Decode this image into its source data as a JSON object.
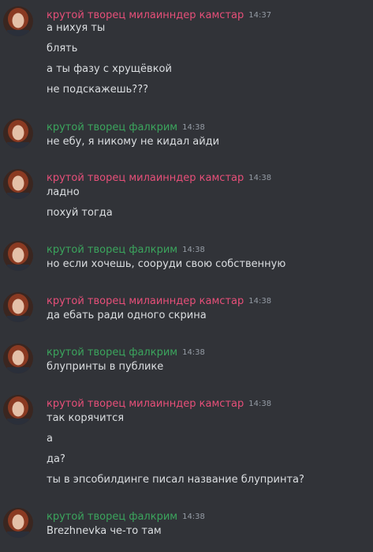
{
  "colors": {
    "background": "#313338",
    "user_pink": "#e74f79",
    "user_green": "#3ba55d",
    "text": "#dbdee1",
    "timestamp": "#949ba4"
  },
  "users": {
    "pink": "крутой творец милаинндер камстар",
    "green": "крутой творец фалкрим"
  },
  "messages": [
    {
      "user": "крутой творец милаинндер камстар",
      "color": "pink",
      "time": "14:37",
      "lines": [
        "а нихуя ты",
        "блять",
        "а ты фазу с хрущёвкой",
        "не подскажешь???"
      ]
    },
    {
      "user": "крутой творец фалкрим",
      "color": "green",
      "time": "14:38",
      "lines": [
        "не ебу, я никому не кидал айди"
      ]
    },
    {
      "user": "крутой творец милаинндер камстар",
      "color": "pink",
      "time": "14:38",
      "lines": [
        "ладно",
        "похуй тогда"
      ]
    },
    {
      "user": "крутой творец фалкрим",
      "color": "green",
      "time": "14:38",
      "lines": [
        "но если хочешь, сооруди свою собственную"
      ]
    },
    {
      "user": "крутой творец милаинндер камстар",
      "color": "pink",
      "time": "14:38",
      "lines": [
        "да ебать ради одного скрина"
      ]
    },
    {
      "user": "крутой творец фалкрим",
      "color": "green",
      "time": "14:38",
      "lines": [
        "блупринты в публике"
      ]
    },
    {
      "user": "крутой творец милаинндер камстар",
      "color": "pink",
      "time": "14:38",
      "lines": [
        "так корячится",
        "а",
        "да?",
        "ты в эпсобилдинге писал название блупринта?"
      ]
    },
    {
      "user": "крутой творец фалкрим",
      "color": "green",
      "time": "14:38",
      "lines": [
        "Brezhnevka че-то там"
      ]
    }
  ]
}
